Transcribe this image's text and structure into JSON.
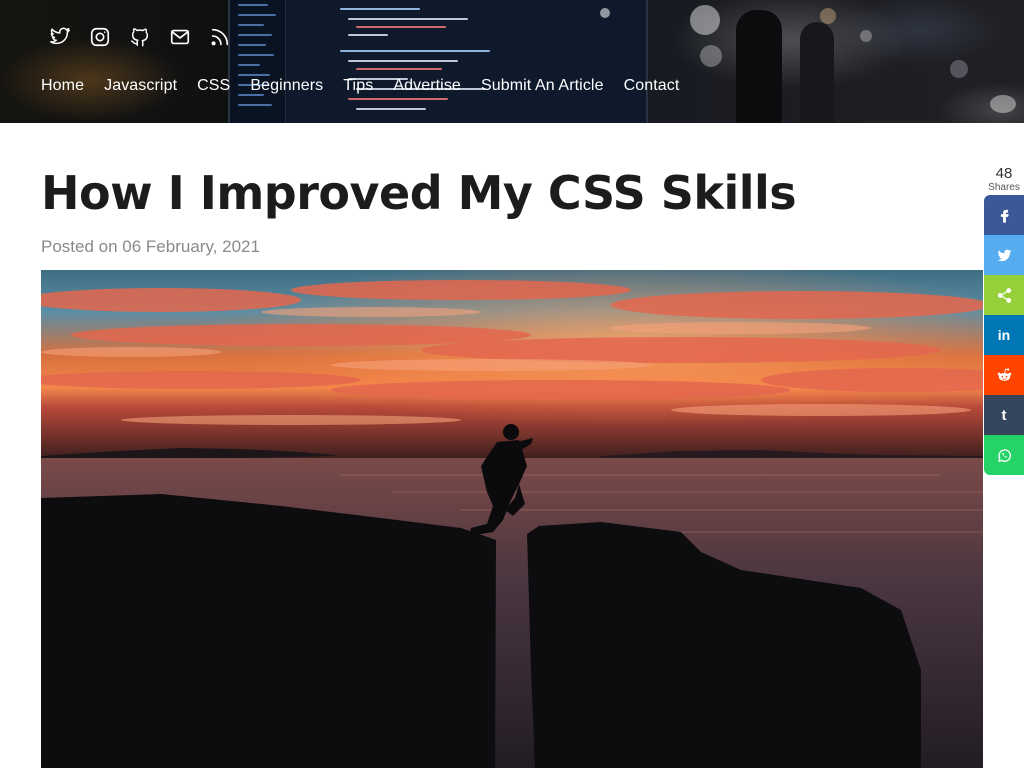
{
  "header": {
    "social_icons": [
      {
        "name": "twitter-icon"
      },
      {
        "name": "instagram-icon"
      },
      {
        "name": "github-icon"
      },
      {
        "name": "mail-icon"
      },
      {
        "name": "rss-icon"
      }
    ],
    "nav": [
      {
        "label": "Home"
      },
      {
        "label": "Javascript"
      },
      {
        "label": "CSS"
      },
      {
        "label": "Beginners"
      },
      {
        "label": "Tips"
      },
      {
        "label": "Advertise"
      },
      {
        "label": "Submit An Article"
      },
      {
        "label": "Contact"
      }
    ]
  },
  "article": {
    "title": "How I Improved My CSS Skills",
    "posted": "Posted on 06 February, 2021"
  },
  "share": {
    "count": "48",
    "label": "Shares",
    "buttons": [
      {
        "name": "facebook-icon",
        "color": "#3b5998"
      },
      {
        "name": "twitter-icon",
        "color": "#55acee"
      },
      {
        "name": "share-icon",
        "color": "#95d03a"
      },
      {
        "name": "linkedin-icon",
        "color": "#0077b5",
        "glyph": "in"
      },
      {
        "name": "reddit-icon",
        "color": "#ff4500"
      },
      {
        "name": "tumblr-icon",
        "color": "#35465c",
        "glyph": "t"
      },
      {
        "name": "whatsapp-icon",
        "color": "#25d366"
      }
    ]
  },
  "colors": {
    "nav_text": "#ffffff",
    "title": "#1c1c1c",
    "meta": "#8a8a8a"
  }
}
